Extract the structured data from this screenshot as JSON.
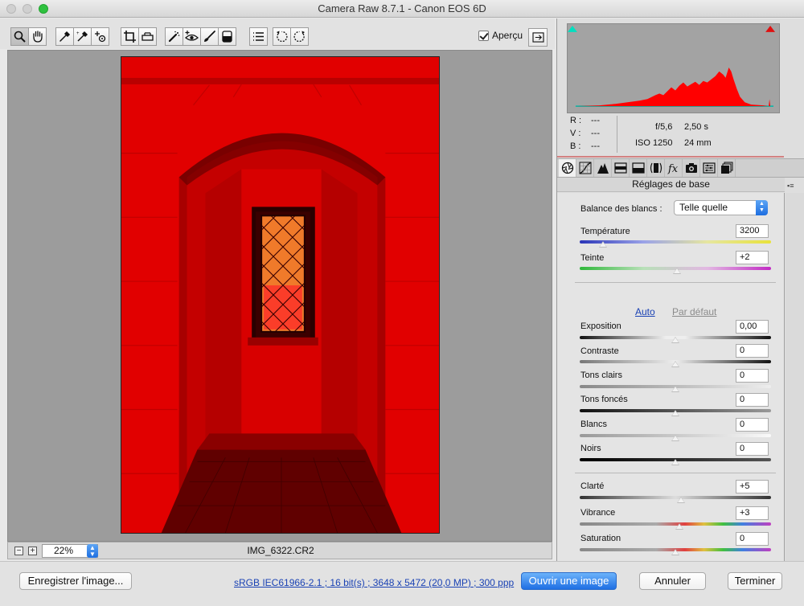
{
  "window": {
    "title": "Camera Raw 8.7.1  -  Canon EOS 6D"
  },
  "toolbar": {
    "tools": [
      {
        "name": "zoom-tool",
        "icon": "magnifier-icon",
        "active": true
      },
      {
        "name": "hand-tool",
        "icon": "hand-icon"
      },
      {
        "name": "white-balance-tool",
        "icon": "eyedropper-icon"
      },
      {
        "name": "color-sampler-tool",
        "icon": "color-sampler-icon"
      },
      {
        "name": "targeted-adjustment-tool",
        "icon": "target-adjust-icon"
      },
      {
        "name": "crop-tool",
        "icon": "crop-icon"
      },
      {
        "name": "straighten-tool",
        "icon": "level-icon"
      },
      {
        "name": "spot-removal-tool",
        "icon": "spot-removal-icon"
      },
      {
        "name": "red-eye-tool",
        "icon": "red-eye-icon"
      },
      {
        "name": "adjustment-brush-tool",
        "icon": "brush-icon"
      },
      {
        "name": "graduated-filter-tool",
        "icon": "graduated-filter-icon"
      },
      {
        "name": "preferences-tool",
        "icon": "list-icon"
      },
      {
        "name": "rotate-left-tool",
        "icon": "rotate-ccw-icon"
      },
      {
        "name": "rotate-right-tool",
        "icon": "rotate-cw-icon"
      }
    ],
    "preview_label": "Aperçu",
    "preview_checked": true
  },
  "statusbar": {
    "zoom_value": "22%",
    "filename": "IMG_6322.CR2"
  },
  "info": {
    "r_label": "R :",
    "v_label": "V :",
    "b_label": "B :",
    "r_value": "---",
    "v_value": "---",
    "b_value": "---",
    "aperture": "f/5,6",
    "shutter": "2,50 s",
    "iso": "ISO 1250",
    "focal": "24 mm"
  },
  "panel": {
    "title": "Réglages de base",
    "white_balance_label": "Balance des blancs :",
    "white_balance_value": "Telle quelle",
    "auto_label": "Auto",
    "default_label": "Par défaut",
    "sliders": {
      "temperature": {
        "label": "Température",
        "value": "3200",
        "position": 0.12
      },
      "tint": {
        "label": "Teinte",
        "value": "+2",
        "position": 0.51
      },
      "exposure": {
        "label": "Exposition",
        "value": "0,00",
        "position": 0.5
      },
      "contrast": {
        "label": "Contraste",
        "value": "0",
        "position": 0.5
      },
      "highlights": {
        "label": "Tons clairs",
        "value": "0",
        "position": 0.5
      },
      "shadows": {
        "label": "Tons foncés",
        "value": "0",
        "position": 0.5
      },
      "whites": {
        "label": "Blancs",
        "value": "0",
        "position": 0.5
      },
      "blacks": {
        "label": "Noirs",
        "value": "0",
        "position": 0.5
      },
      "clarity": {
        "label": "Clarté",
        "value": "+5",
        "position": 0.53
      },
      "vibrance": {
        "label": "Vibrance",
        "value": "+3",
        "position": 0.52
      },
      "saturation": {
        "label": "Saturation",
        "value": "0",
        "position": 0.5
      }
    }
  },
  "bottom": {
    "save_label": "Enregistrer l'image...",
    "workflow_info": "sRGB IEC61966-2.1 ; 16 bit(s) ; 3648 x 5472 (20,0 MP) ; 300 ppp",
    "open_label": "Ouvrir une image",
    "cancel_label": "Annuler",
    "done_label": "Terminer"
  },
  "colors": {
    "photo_tint": "#ff0000",
    "accent_blue": "#2f80ee",
    "histogram_red": "#ff0000",
    "clip_shadow": "#00e0c0",
    "clip_highlight": "#e01010"
  }
}
